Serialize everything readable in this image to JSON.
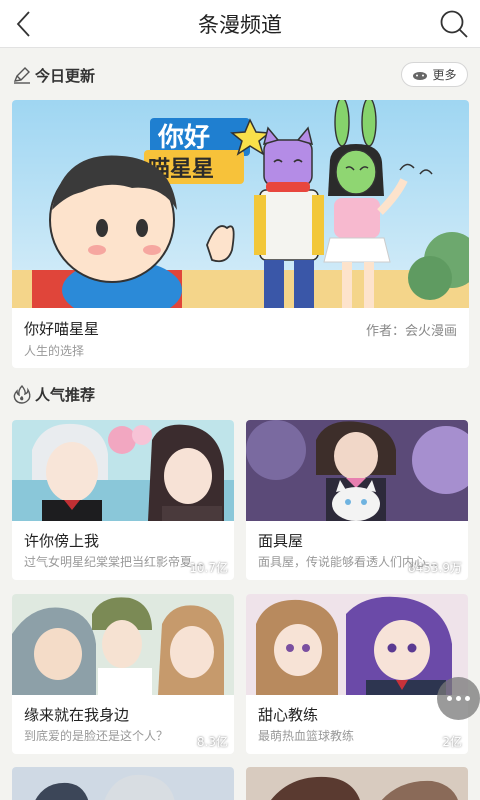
{
  "header": {
    "title": "条漫频道",
    "back_icon": "back-chevron-icon",
    "search_icon": "search-icon"
  },
  "today": {
    "section_title": "今日更新",
    "more_label": "更多",
    "feature": {
      "cover_title": "你好 喵星星",
      "name": "你好喵星星",
      "author": "作者：会火漫画",
      "subtitle": "人生的选择"
    }
  },
  "popular": {
    "section_title": "人气推荐",
    "items": [
      {
        "name": "许你傍上我",
        "desc": "过气女明星纪棠棠把当红影帝夏…",
        "hot": "10.7亿"
      },
      {
        "name": "面具屋",
        "desc": "面具屋，传说能够看透人们内心…",
        "hot": "8453.9万"
      },
      {
        "name": "缘来就在我身边",
        "desc": "到底爱的是脸还是这个人？",
        "hot": "8.3亿"
      },
      {
        "name": "甜心教练",
        "desc": "最萌热血篮球教练",
        "hot": "2亿"
      }
    ]
  },
  "colors": {
    "accent": "#f5c400",
    "bg": "#f3f3f0",
    "card": "#ffffff"
  }
}
